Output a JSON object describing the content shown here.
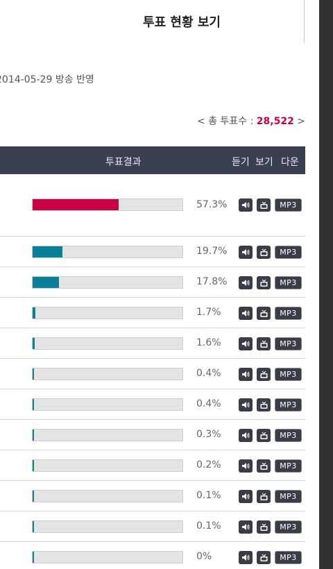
{
  "header": {
    "title": "투표 현황 보기"
  },
  "broadcast": {
    "info": "2014-05-29 방송 반영"
  },
  "totals": {
    "prefix": "< 총 투표수 : ",
    "count": "28,522",
    "suffix": " >"
  },
  "table": {
    "col_result": "투표결과",
    "col_listen": "듣기",
    "col_view": "보기",
    "col_download": "다운"
  },
  "icons": {
    "mp3_label": "MP3",
    "listen_icon": "speaker-icon",
    "view_icon": "tv-icon"
  },
  "colors": {
    "winner": "#cc0044",
    "others": "#0a7f99",
    "accent": "#cc0044"
  },
  "results": [
    {
      "percent_label": "57.3%",
      "value": 57.3
    },
    {
      "percent_label": "19.7%",
      "value": 19.7
    },
    {
      "percent_label": "17.8%",
      "value": 17.8
    },
    {
      "percent_label": "1.7%",
      "value": 1.7
    },
    {
      "percent_label": "1.6%",
      "value": 1.6
    },
    {
      "percent_label": "0.4%",
      "value": 0.4
    },
    {
      "percent_label": "0.4%",
      "value": 0.4
    },
    {
      "percent_label": "0.3%",
      "value": 0.3
    },
    {
      "percent_label": "0.2%",
      "value": 0.2
    },
    {
      "percent_label": "0.1%",
      "value": 0.1
    },
    {
      "percent_label": "0.1%",
      "value": 0.1
    },
    {
      "percent_label": "0%",
      "value": 0
    }
  ]
}
